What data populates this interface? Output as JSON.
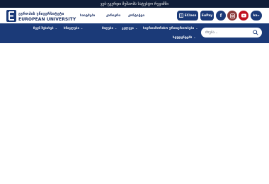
{
  "announcement": "ვებ-გვერდი მუშაობს სატესტო რეჟიმში",
  "logo": {
    "line1": "ევროპის უნივერსიტეტი",
    "line2": "EUROPEAN UNIVERSITY"
  },
  "header_nav": [
    "საიტმეპი",
    "კარიერა",
    "კონტაქტი"
  ],
  "buttons": {
    "eclass": "EClass",
    "epay": "EuPay"
  },
  "socials": [
    {
      "icon": "facebook-icon",
      "color": "#1b3a78"
    },
    {
      "icon": "instagram-icon",
      "color": "#8a3a3a"
    },
    {
      "icon": "youtube-icon",
      "color": "#c0111f"
    }
  ],
  "language": "ka",
  "main_nav": [
    "ჩვენ შესახებ",
    "სწავლება",
    "მიღება",
    "კვლევა",
    "საერთაშორისო ურთიერთობები",
    "სტუდენტებს"
  ],
  "search": {
    "placeholder": "ძიება..."
  },
  "colors": {
    "primary": "#1b3a78",
    "topbar": "#111e38",
    "youtube": "#c0111f"
  }
}
